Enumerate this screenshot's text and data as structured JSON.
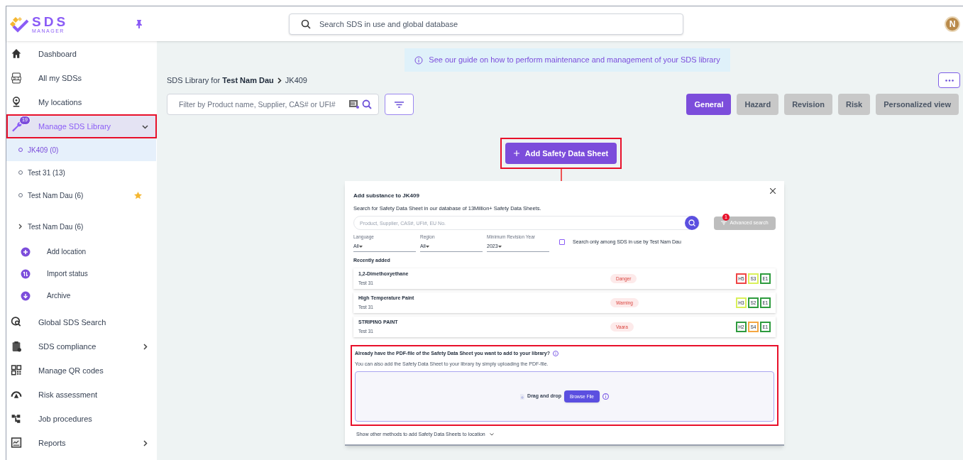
{
  "logo": {
    "title": "SDS",
    "subtitle": "MANAGER"
  },
  "search": {
    "placeholder": "Search SDS in use and global database"
  },
  "avatar": {
    "initial": "N"
  },
  "sidebar": {
    "items": [
      {
        "kind": "nav",
        "label": "Dashboard",
        "selected": false
      },
      {
        "kind": "nav",
        "label": "All my SDSs",
        "selected": false
      },
      {
        "kind": "nav",
        "label": "My locations",
        "selected": false
      },
      {
        "kind": "nav",
        "label": "Manage SDS Library",
        "selected": true,
        "badge": "19",
        "expanded": true,
        "highlighted": true
      },
      {
        "kind": "location",
        "label": "JK409 (0)",
        "selected": true,
        "starred": false
      },
      {
        "kind": "location",
        "label": "Test 31 (13)",
        "selected": false,
        "starred": false
      },
      {
        "kind": "location",
        "label": "Test Nam Dau (6)",
        "selected": false,
        "starred": true
      },
      {
        "kind": "subtree",
        "label": "Test Nam Dau (6)"
      },
      {
        "kind": "action",
        "label": "Add location"
      },
      {
        "kind": "action",
        "label": "Import status"
      },
      {
        "kind": "action",
        "label": "Archive"
      },
      {
        "kind": "nav",
        "label": "Global SDS Search",
        "selected": false
      },
      {
        "kind": "nav",
        "label": "SDS compliance",
        "selected": false,
        "expanded": false
      },
      {
        "kind": "nav",
        "label": "Manage QR codes",
        "selected": false
      },
      {
        "kind": "nav",
        "label": "Risk assessment",
        "selected": false
      },
      {
        "kind": "nav",
        "label": "Job procedures",
        "selected": false
      },
      {
        "kind": "nav",
        "label": "Reports",
        "selected": false,
        "expanded": false
      }
    ]
  },
  "guide": {
    "text": "See our guide on how to perform maintenance and management of your SDS library"
  },
  "breadcrumb": {
    "prefix": "SDS Library for ",
    "owner": "Test Nam Dau",
    "current": "JK409"
  },
  "filter": {
    "placeholder": "Filter by Product name, Supplier, CAS# or UFI#"
  },
  "tabs": [
    {
      "label": "General",
      "selected": true
    },
    {
      "label": "Hazard",
      "selected": false
    },
    {
      "label": "Revision",
      "selected": false
    },
    {
      "label": "Risk",
      "selected": false
    },
    {
      "label": "Personalized view",
      "selected": false
    }
  ],
  "add_button": {
    "label": "Add Safety Data Sheet",
    "highlighted": true
  },
  "modal": {
    "title": "Add substance to JK409",
    "subtitle": "Search for Safety Data Sheet in our database of 13Million+ Safety Data Sheets.",
    "search": {
      "placeholder": "Product, Supplier, CAS#, UFI#, EU No."
    },
    "advanced": {
      "label": "Advanced search",
      "badge": "1"
    },
    "selects": [
      {
        "label": "Language",
        "value": "All"
      },
      {
        "label": "Region",
        "value": "All"
      },
      {
        "label": "Minimum Revision Year",
        "value": "2023"
      }
    ],
    "only_in_use": {
      "label": "Search only among SDS in use by Test Nam Dau",
      "checked": false
    },
    "recent_title": "Recently added",
    "recent": [
      {
        "name": "1,2-Dimethoxyethane",
        "location": "Test 31",
        "signal": "Danger",
        "ratings": [
          {
            "label": "H5",
            "color": "#ef4444"
          },
          {
            "label": "S3",
            "color": "#d9f05a"
          },
          {
            "label": "E1",
            "color": "#2e9b3e"
          }
        ]
      },
      {
        "name": "High Temperature Paint",
        "location": "Test 31",
        "signal": "Warning",
        "ratings": [
          {
            "label": "H3",
            "color": "#d9f05a"
          },
          {
            "label": "S2",
            "color": "#2e9b3e"
          },
          {
            "label": "E1",
            "color": "#2e9b3e"
          }
        ]
      },
      {
        "name": "STRIPING PAINT",
        "location": "Test 31",
        "signal": "Vaara",
        "ratings": [
          {
            "label": "H2",
            "color": "#2e9b3e"
          },
          {
            "label": "S4",
            "color": "#f5a742"
          },
          {
            "label": "E1",
            "color": "#2e9b3e"
          }
        ]
      }
    ],
    "upload": {
      "title": "Already have the PDF-file of the Safety Data Sheet you want to add to your library?",
      "text": "You can also add the Safety Data Sheet to your library by simply uploading the PDF-file.",
      "drop_label": "Drag and drop",
      "browse": "Browse File",
      "highlighted": true
    },
    "more_methods": "Show other methods to add Safety Data Sheets to location"
  }
}
